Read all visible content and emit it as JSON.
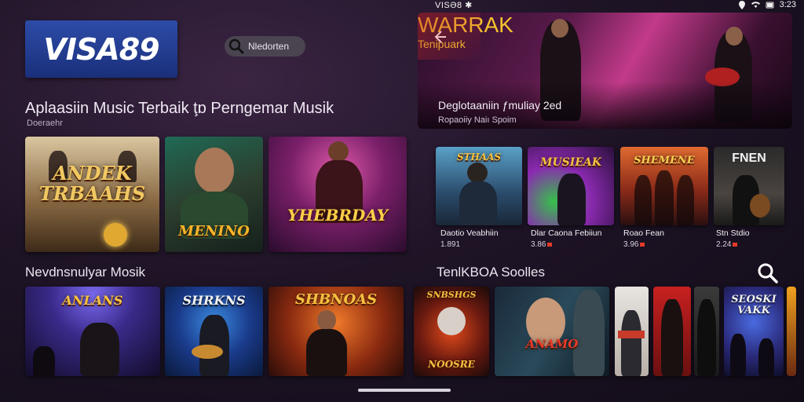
{
  "status": {
    "carrier": "VISƏ8 ✱",
    "time": "3:23"
  },
  "logo": {
    "text": "VISA89"
  },
  "search": {
    "label": "Nledorten"
  },
  "headline": {
    "title": "Aplaasiin Music Terbaik ţɒ Perngemar Musik",
    "subtitle": "Doeraehr"
  },
  "row1": [
    {
      "art": "ANDEK TRBAAHS"
    },
    {
      "art": "MENINO"
    },
    {
      "art": "YHEBRDAY"
    }
  ],
  "hero": {
    "art": "WARRAK",
    "art_sub": "Tenipuark",
    "title": "Deglotaaniin ƒmuliay 2ed",
    "subtitle": "Ropaoiiy Naiı Spoim"
  },
  "featured": [
    {
      "art": "STHAAS",
      "label": "Daotio Veabhiin",
      "meta": "1.891"
    },
    {
      "art": "MUSIEAK",
      "label": "Dlar Caona Febiiun",
      "meta": "3.86"
    },
    {
      "art": "SHEMENE",
      "label": "Roao Fean",
      "meta": "3.96"
    },
    {
      "art": "FNEN",
      "label": "Stn Stdio",
      "meta": "2.24"
    }
  ],
  "section2": {
    "title": "Nevdnsnulyar Mosik"
  },
  "row2": [
    {
      "art": "ANLANS"
    },
    {
      "art": "SHRKNS"
    },
    {
      "art": "SHBNOAS"
    }
  ],
  "section3": {
    "title": "TenlKBOA Soolles"
  },
  "row3": [
    {
      "art": "SNBSHGS",
      "art_sub": "NOOSRE"
    },
    {
      "art": "ANAMO"
    },
    {
      "art": ""
    },
    {
      "art": ""
    },
    {
      "art": ""
    },
    {
      "art": "SEOSKI VAKK"
    }
  ],
  "colors": {
    "accent": "#f2b22b",
    "brand": "#2d4ca8",
    "badge": "#e23b2a"
  }
}
